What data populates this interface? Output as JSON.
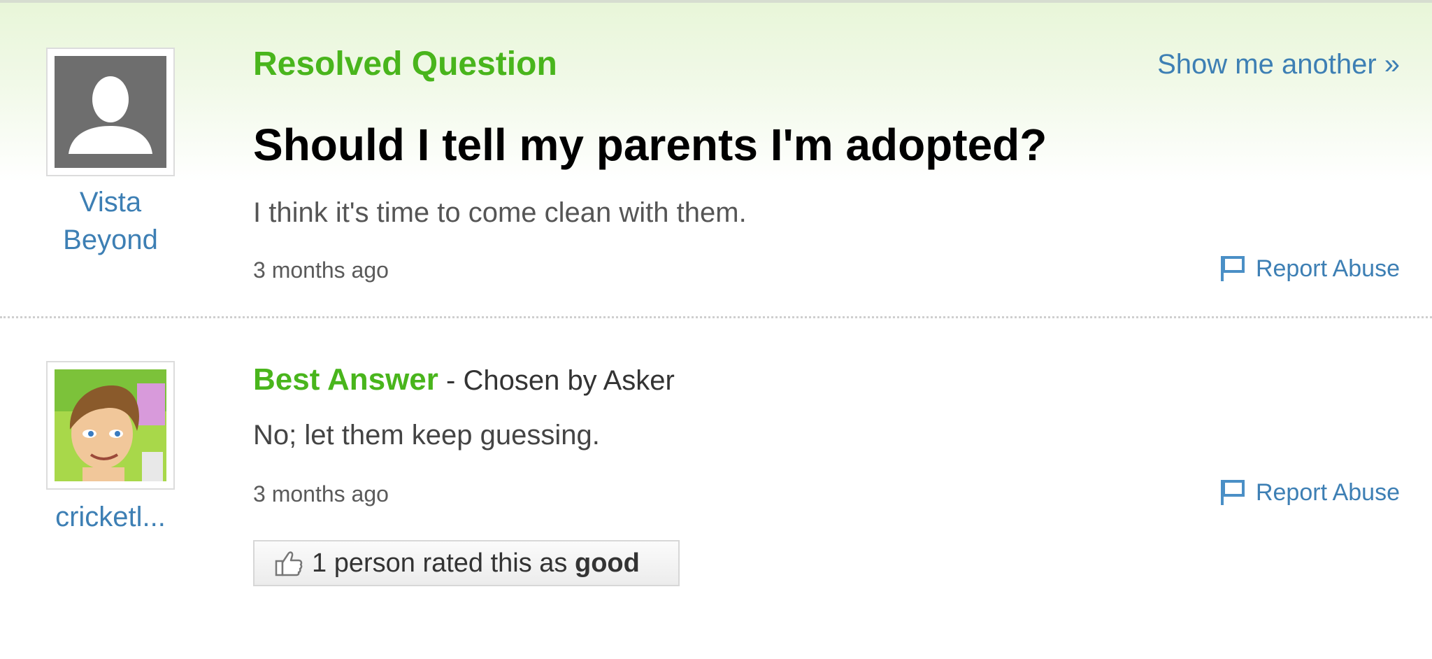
{
  "question": {
    "status_label": "Resolved Question",
    "show_another_label": "Show me another »",
    "title": "Should I tell my parents I'm adopted?",
    "body": "I think it's time to come clean with them.",
    "timestamp": "3 months ago",
    "report_label": "Report Abuse",
    "asker": {
      "name_line1": "Vista",
      "name_line2": "Beyond",
      "avatar_icon": "generic-user-silhouette-icon"
    }
  },
  "answer": {
    "best_label": "Best Answer",
    "chosen_text": " - Chosen by Asker",
    "body": "No; let them keep guessing.",
    "timestamp": "3 months ago",
    "report_label": "Report Abuse",
    "rating_prefix": "1 person rated this as ",
    "rating_value": "good",
    "rating_icon": "thumbs-up-icon",
    "answerer": {
      "name": "cricketl...",
      "avatar_icon": "cartoon-avatar-icon"
    }
  },
  "colors": {
    "accent_green": "#49b51c",
    "link_blue": "#3d7fb4",
    "header_bg_green": "#e8f6d8"
  }
}
